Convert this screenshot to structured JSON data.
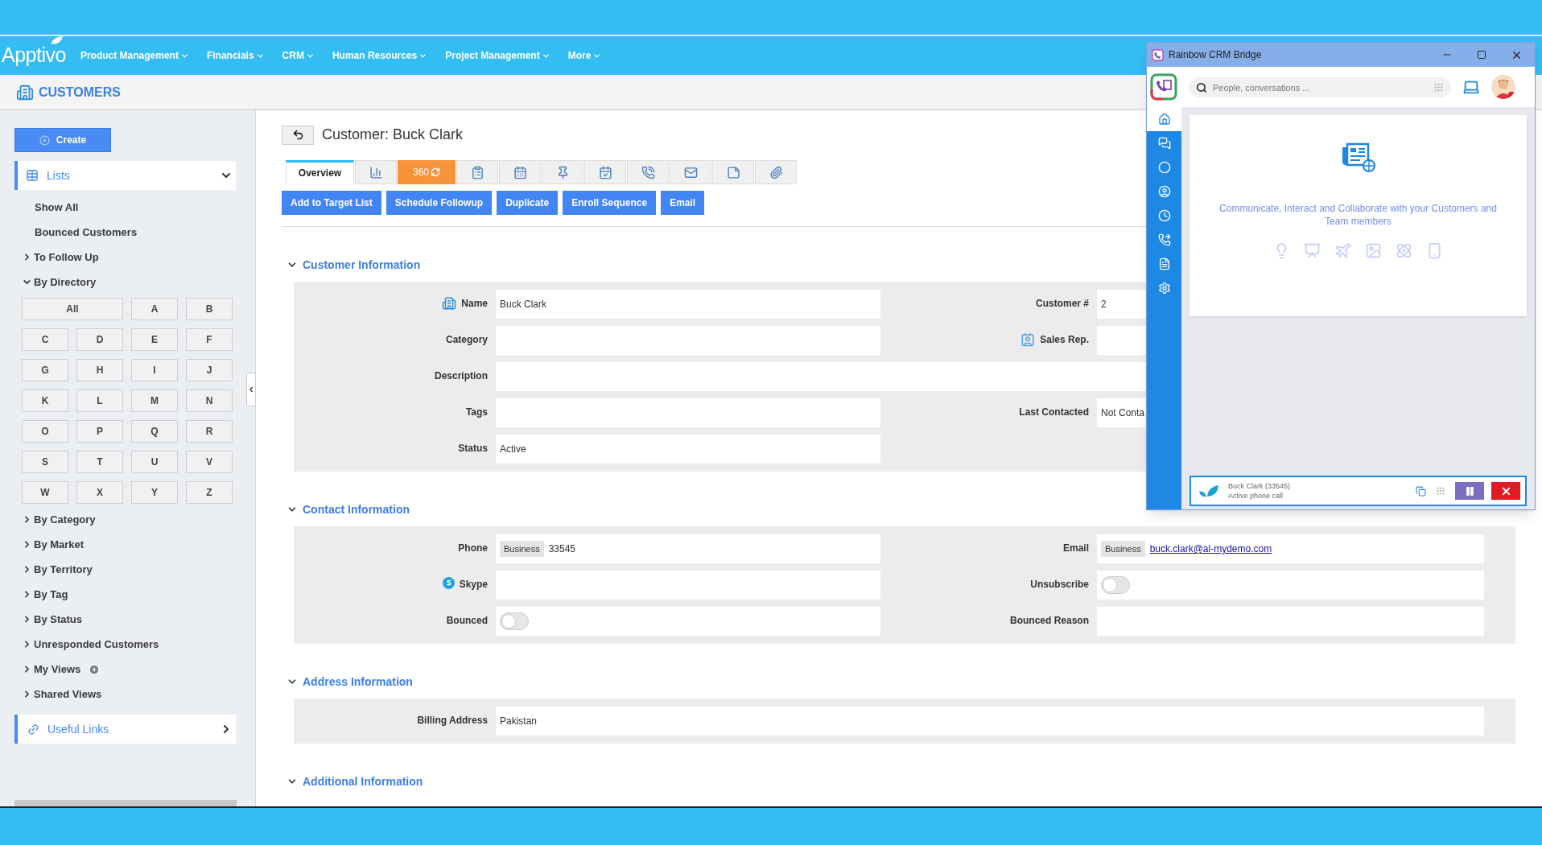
{
  "nav": {
    "logo": "Apptivo",
    "items": [
      {
        "label": "Product Management"
      },
      {
        "label": "Financials"
      },
      {
        "label": "CRM"
      },
      {
        "label": "Human Resources"
      },
      {
        "label": "Project Management"
      },
      {
        "label": "More"
      }
    ]
  },
  "app_header": {
    "title": "CUSTOMERS"
  },
  "sidebar": {
    "create": "Create",
    "lists": {
      "label": "Lists",
      "expanded": true
    },
    "items": [
      {
        "label": "Show All",
        "kind": "plain"
      },
      {
        "label": "Bounced Customers",
        "kind": "plain"
      },
      {
        "label": "To Follow Up",
        "kind": "group",
        "expanded": false
      },
      {
        "label": "By Directory",
        "kind": "group",
        "expanded": true,
        "letters": [
          "All",
          "A",
          "B",
          "C",
          "D",
          "E",
          "F",
          "G",
          "H",
          "I",
          "J",
          "K",
          "L",
          "M",
          "N",
          "O",
          "P",
          "Q",
          "R",
          "S",
          "T",
          "U",
          "V",
          "W",
          "X",
          "Y",
          "Z"
        ]
      },
      {
        "label": "By Category",
        "kind": "group",
        "expanded": false
      },
      {
        "label": "By Market",
        "kind": "group",
        "expanded": false
      },
      {
        "label": "By Territory",
        "kind": "group",
        "expanded": false
      },
      {
        "label": "By Tag",
        "kind": "group",
        "expanded": false
      },
      {
        "label": "By Status",
        "kind": "group",
        "expanded": false
      },
      {
        "label": "Unresponded Customers",
        "kind": "group",
        "expanded": false
      },
      {
        "label": "My Views",
        "kind": "group-add",
        "expanded": false
      },
      {
        "label": "Shared Views",
        "kind": "group",
        "expanded": false
      }
    ],
    "useful_links": {
      "label": "Useful Links",
      "expanded": false
    }
  },
  "record": {
    "title": "Customer: Buck Clark",
    "tabs": [
      {
        "kind": "text",
        "label": "Overview",
        "selected": true
      },
      {
        "kind": "icon",
        "selected": false
      },
      {
        "kind": "accent",
        "label": "360",
        "selected": false
      },
      {
        "kind": "icon",
        "selected": false
      },
      {
        "kind": "icon",
        "selected": false
      },
      {
        "kind": "icon",
        "selected": false
      },
      {
        "kind": "icon",
        "selected": false
      },
      {
        "kind": "icon",
        "selected": false
      },
      {
        "kind": "icon",
        "selected": false
      },
      {
        "kind": "icon",
        "selected": false
      },
      {
        "kind": "icon",
        "selected": false
      }
    ],
    "actions": [
      "Add to Target List",
      "Schedule Followup",
      "Duplicate",
      "Enroll Sequence",
      "Email"
    ],
    "sections": [
      {
        "title": "Customer Information",
        "expanded": true,
        "rows": [
          [
            {
              "label": "Name",
              "kind": "text",
              "value": "Buck Clark"
            },
            {
              "label": "Customer #",
              "kind": "text",
              "value": "2"
            }
          ],
          [
            {
              "label": "Category",
              "kind": "text"
            },
            {
              "label": "Sales Rep.",
              "kind": "text"
            }
          ],
          [
            {
              "label": "Description",
              "kind": "wide"
            }
          ],
          [
            {
              "label": "Tags",
              "kind": "text"
            },
            {
              "label": "Last Contacted",
              "kind": "text",
              "value": "Not Conta"
            }
          ],
          [
            {
              "label": "Status",
              "kind": "text",
              "value": "Active"
            }
          ]
        ]
      },
      {
        "title": "Contact Information",
        "expanded": true,
        "rows": [
          [
            {
              "label": "Phone",
              "kind": "tagged",
              "tag": "Business",
              "value": "33545"
            },
            {
              "label": "Email",
              "kind": "link",
              "tag": "Business",
              "value": "buck.clark@al-mydemo.com"
            }
          ],
          [
            {
              "label": "Skype",
              "kind": "text"
            },
            {
              "label": "Unsubscribe",
              "kind": "toggle",
              "on": false
            }
          ],
          [
            {
              "label": "Bounced",
              "kind": "toggle",
              "on": false
            },
            {
              "label": "Bounced Reason",
              "kind": "text"
            }
          ]
        ]
      },
      {
        "title": "Address Information",
        "expanded": true,
        "rows": [
          [
            {
              "label": "Billing Address",
              "kind": "wide",
              "value": "Pakistan"
            }
          ]
        ]
      },
      {
        "title": "Additional Information",
        "expanded": true
      }
    ]
  },
  "rainbow": {
    "title": "Rainbow CRM Bridge",
    "search": {
      "placeholder": "People, conversations ..."
    },
    "rail": [
      {
        "selected": true
      },
      {
        "selected": false
      },
      {
        "selected": false
      },
      {
        "selected": false
      },
      {
        "selected": false
      },
      {
        "selected": false
      },
      {
        "selected": false
      },
      {
        "selected": false
      }
    ],
    "welcome": "Communicate, Interact and Collaborate with your Customers and Team members",
    "call": {
      "name": "Buck Clark (33545)",
      "status": "Active phone call"
    }
  }
}
